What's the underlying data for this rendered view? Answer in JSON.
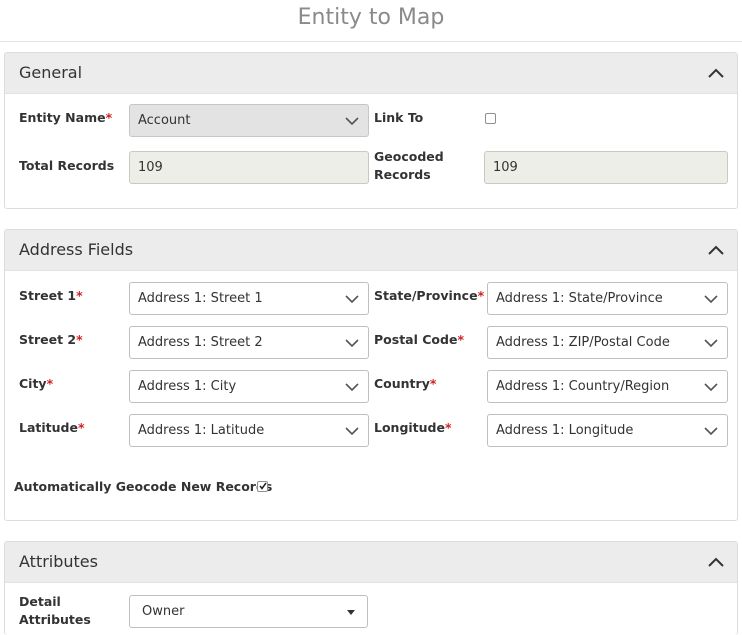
{
  "page": {
    "title": "Entity to Map"
  },
  "general": {
    "title": "General",
    "entity_name_label": "Entity Name",
    "entity_name_value": "Account",
    "link_to_label": "Link To",
    "link_to_checked": false,
    "total_records_label": "Total Records",
    "total_records_value": "109",
    "geocoded_label_line1": "Geocoded",
    "geocoded_label_line2": "Records",
    "geocoded_value": "109"
  },
  "address": {
    "title": "Address Fields",
    "street1_label": "Street 1",
    "street1_value": "Address 1: Street 1",
    "street2_label": "Street 2",
    "street2_value": "Address 1: Street 2",
    "city_label": "City",
    "city_value": "Address 1: City",
    "latitude_label": "Latitude",
    "latitude_value": "Address 1: Latitude",
    "state_label": "State/Province",
    "state_value": "Address 1: State/Province",
    "postal_label": "Postal Code",
    "postal_value": "Address 1: ZIP/Postal Code",
    "country_label": "Country",
    "country_value": "Address 1: Country/Region",
    "longitude_label": "Longitude",
    "longitude_value": "Address 1: Longitude",
    "auto_geocode_label": "Automatically Geocode New Records",
    "auto_geocode_checked": true
  },
  "attributes": {
    "title": "Attributes",
    "detail_label_line1": "Detail",
    "detail_label_line2": "Attributes",
    "detail_value": "Owner"
  },
  "required_marker": "*",
  "colors": {
    "required": "#d02020",
    "header_bg": "#ececec",
    "title": "#8a8a8a"
  }
}
